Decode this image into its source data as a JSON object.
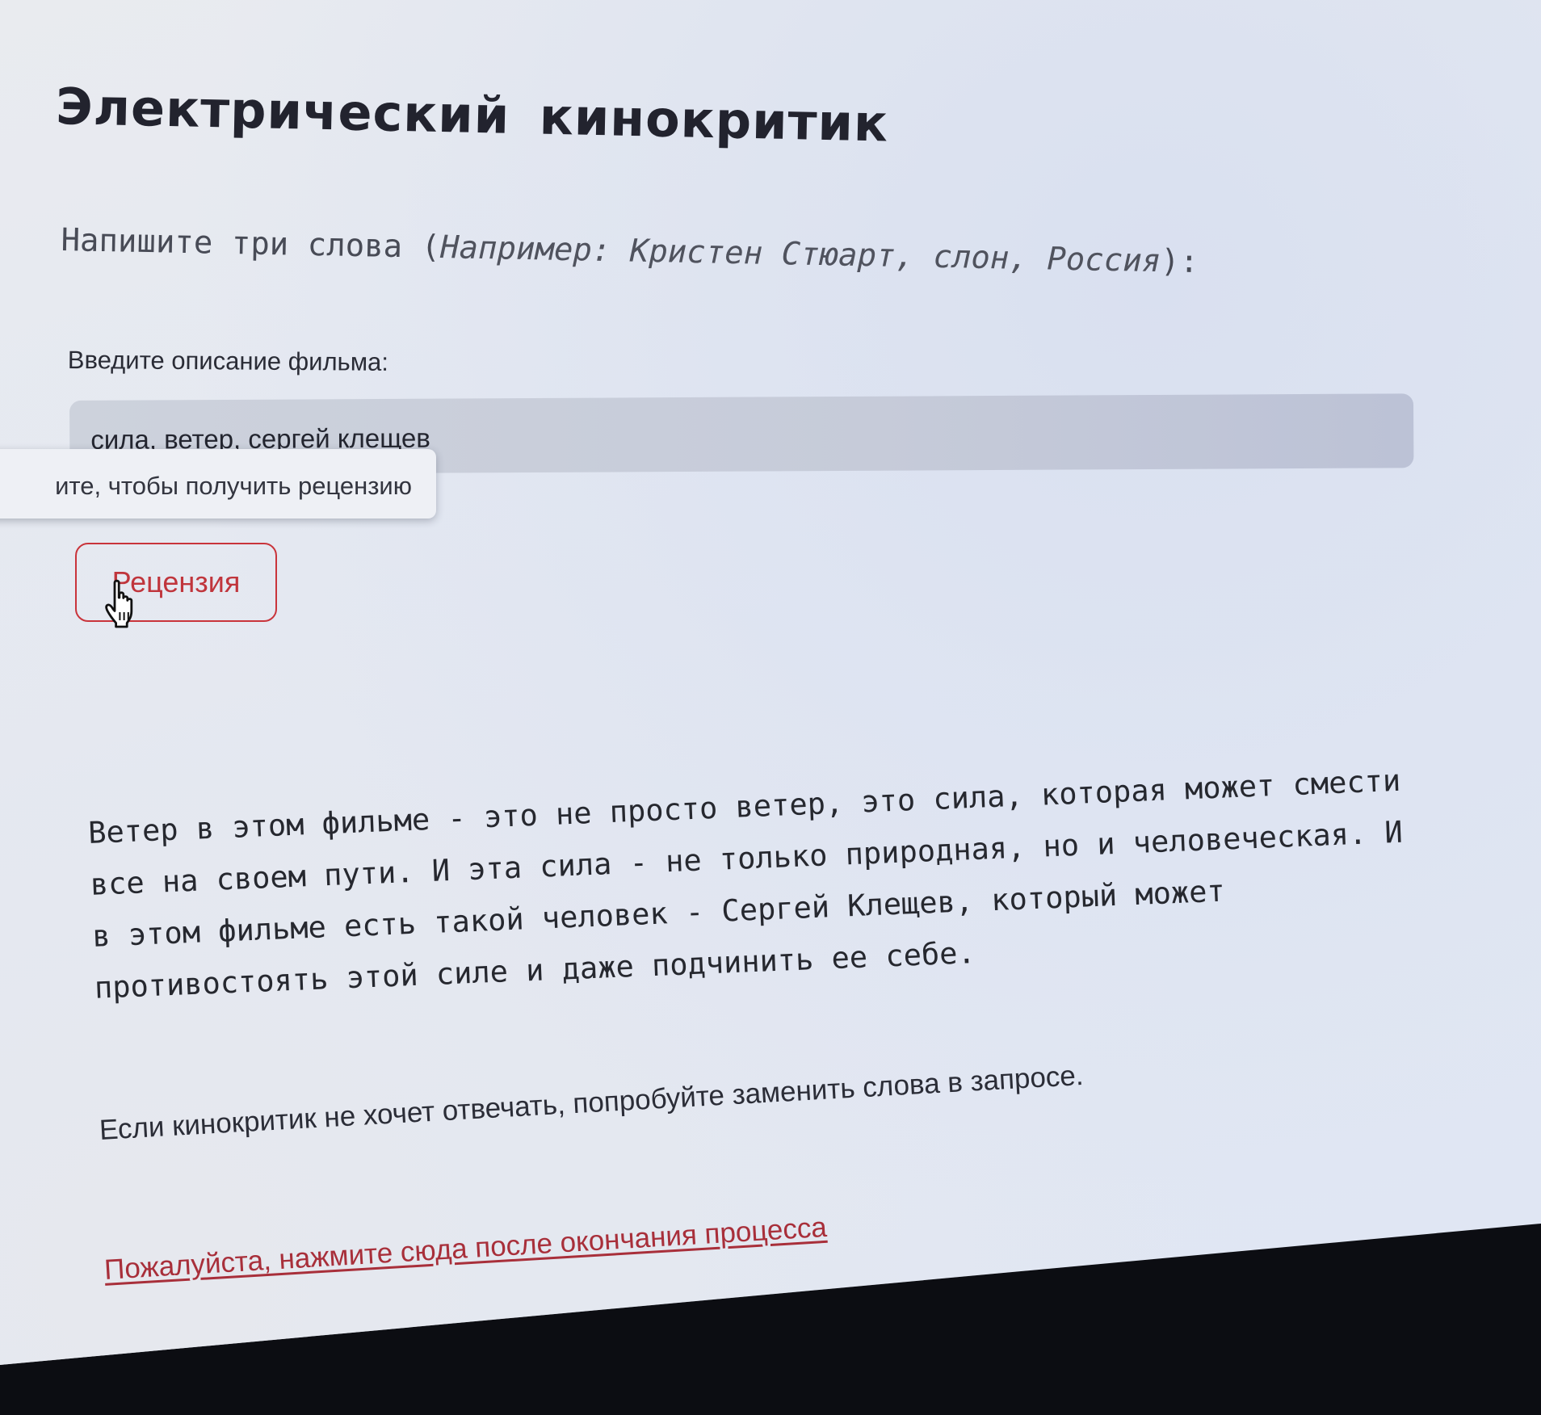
{
  "app": {
    "title": "Электрический кинокритик"
  },
  "instruction": {
    "prefix": "Напишите три слова (",
    "example": "Например: Кристен Стюарт, слон, Россия",
    "suffix": "):"
  },
  "description_field": {
    "label": "Введите описание фильма:",
    "value": "сила, ветер, сергей клещев"
  },
  "tooltip": {
    "text": "ите, чтобы получить рецензию"
  },
  "review_button": {
    "label": "Рецензия"
  },
  "review": {
    "text": "Ветер в этом фильме - это не просто ветер, это сила, которая может смести\nвсе на своем пути. И эта сила - не только природная, но и человеческая. И\nв этом фильме есть такой человек - Сергей Клещев, который может\nпротивостоять этой силе и даже подчинить ее себе."
  },
  "hint": {
    "text": "Если кинокритик не хочет отвечать, попробуйте заменить слова в запросе."
  },
  "finish_link": {
    "text": "Пожалуйста, нажмите сюда после окончания процесса"
  },
  "colors": {
    "accent": "#c9343b",
    "link": "#a82f3a",
    "input_background": "#c6cbd9",
    "page_background": "#e4e8f1",
    "bezel": "#0c0d12"
  },
  "icons": {
    "cursor": "hand-pointer-icon"
  }
}
